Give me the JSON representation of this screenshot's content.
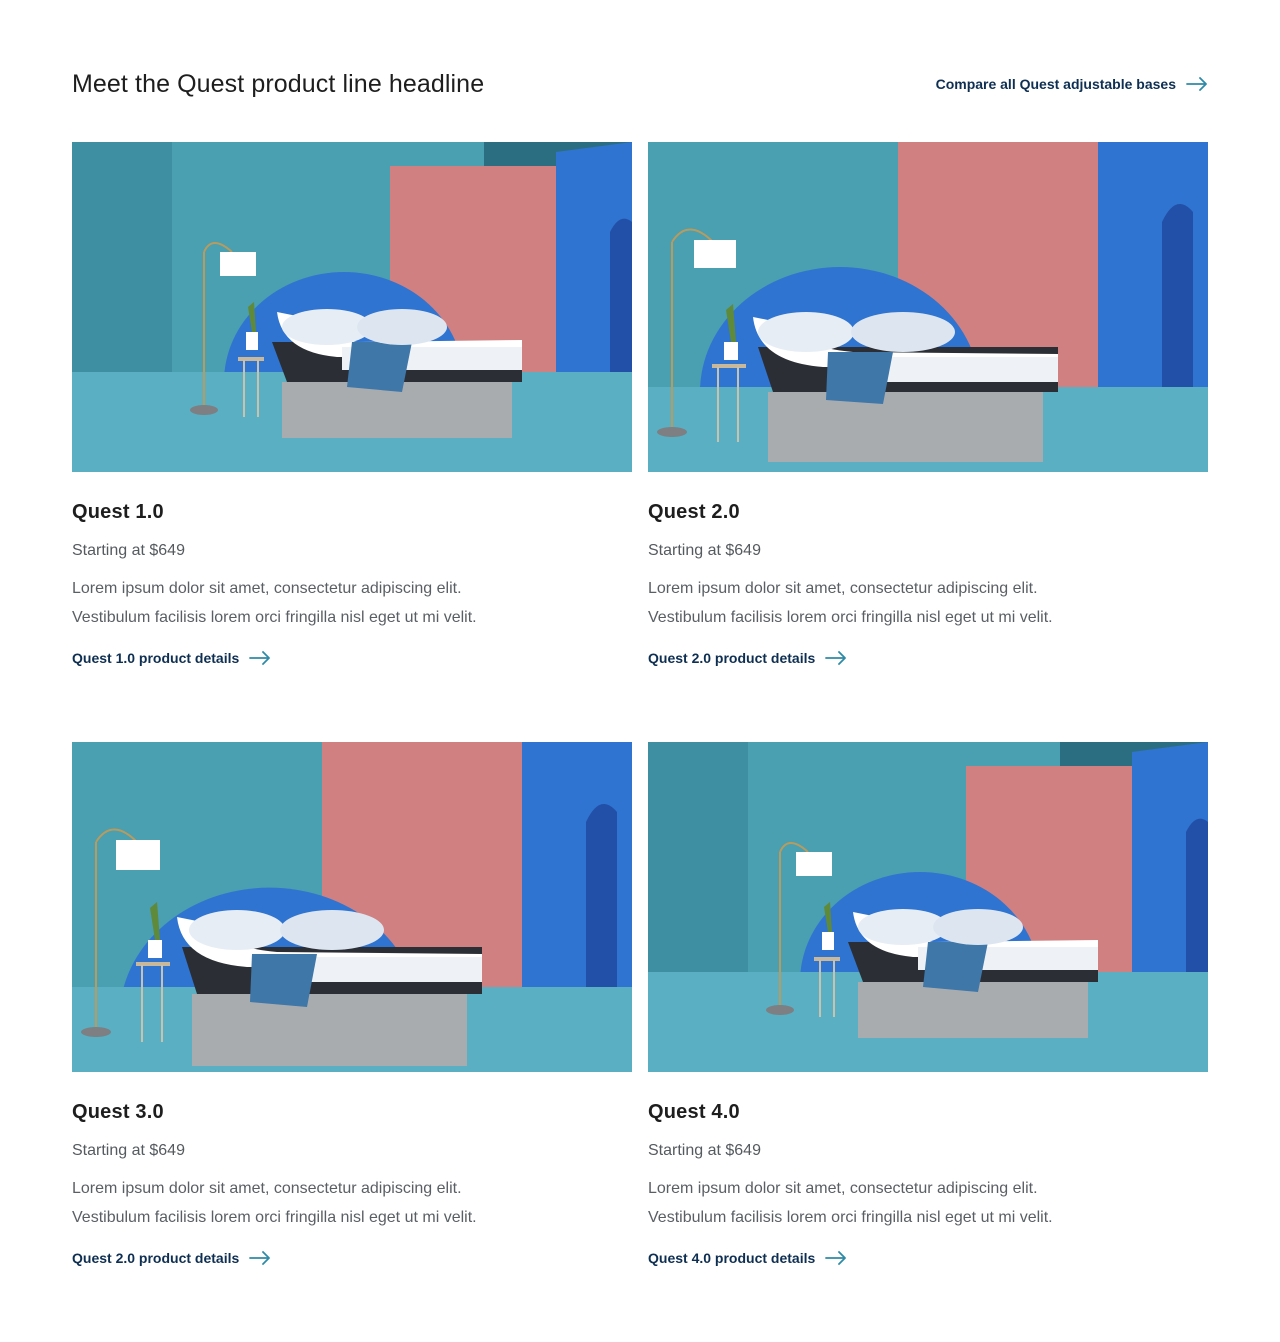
{
  "header": {
    "headline": "Meet the Quest product line headline",
    "compare_link": "Compare all Quest adjustable bases"
  },
  "products": [
    {
      "name": "Quest 1.0",
      "price": "Starting at $649",
      "description": "Lorem ipsum dolor sit amet, consectetur adipiscing elit. Vestibulum facilisis lorem orci fringilla nisl eget ut mi velit.",
      "link": "Quest 1.0 product details"
    },
    {
      "name": "Quest 2.0",
      "price": "Starting at $649",
      "description": "Lorem ipsum dolor sit amet, consectetur adipiscing elit. Vestibulum facilisis lorem orci fringilla nisl eget ut mi velit.",
      "link": "Quest 2.0 product details"
    },
    {
      "name": "Quest 3.0",
      "price": "Starting at $649",
      "description": "Lorem ipsum dolor sit amet, consectetur adipiscing elit. Vestibulum facilisis lorem orci fringilla nisl eget ut mi velit.",
      "link": "Quest 2.0 product details"
    },
    {
      "name": "Quest 4.0",
      "price": "Starting at $649",
      "description": "Lorem ipsum dolor sit amet, consectetur adipiscing elit. Vestibulum facilisis lorem orci fringilla nisl eget ut mi velit.",
      "link": "Quest 4.0 product details"
    }
  ],
  "colors": {
    "link": "#0e2f52",
    "arrow": "#2f8aa8",
    "scene_teal": "#4aa3b4",
    "scene_pink": "#d88a8a",
    "scene_blue": "#2f74d0"
  },
  "icons": {
    "arrow": "arrow-right-icon"
  }
}
